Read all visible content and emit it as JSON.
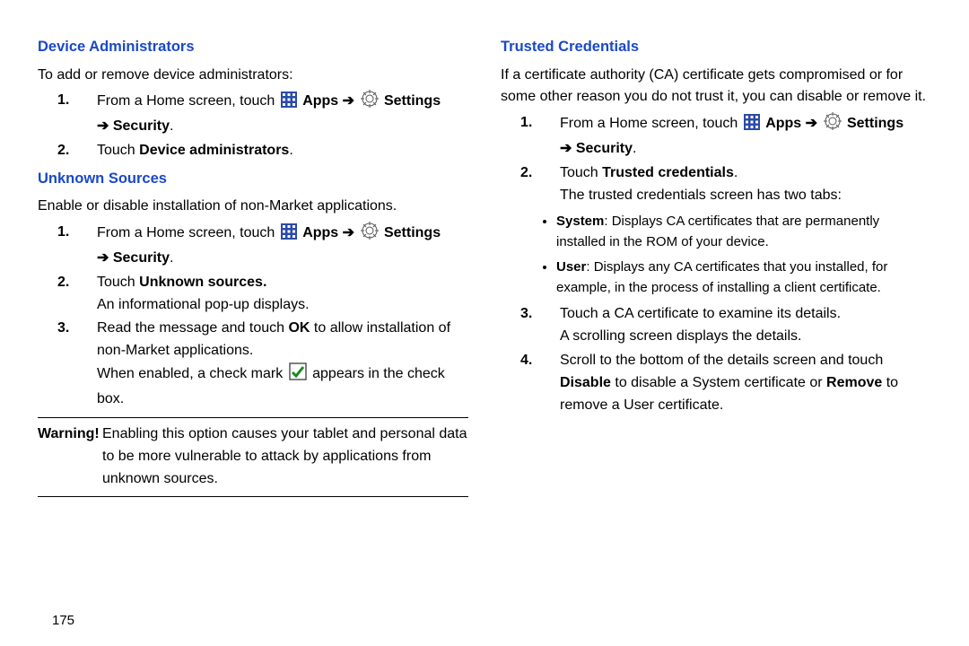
{
  "left": {
    "heading1": "Device Administrators",
    "intro1": "To add or remove device administrators:",
    "step1_pre": "From a Home screen, touch ",
    "apps": "Apps",
    "settings": "Settings",
    "security": "Security",
    "step2_pre": "Touch ",
    "step2_bold": "Device administrators",
    "heading2": "Unknown Sources",
    "intro2": "Enable or disable installation of non-Market applications.",
    "us_step1_pre": "From a Home screen, touch ",
    "us_step2_pre": "Touch ",
    "us_step2_bold": "Unknown sources.",
    "us_step2_after": "An informational pop-up displays.",
    "us_step3_pre": "Read the message and touch ",
    "us_step3_bold": "OK",
    "us_step3_post": " to allow installation of non-Market applications.",
    "us_step3_after_pre": "When enabled, a check mark ",
    "us_step3_after_post": " appears in the check box.",
    "warning_label": "Warning!",
    "warning_body": "Enabling this option causes your tablet and personal data to be more vulnerable to attack by applications from unknown sources."
  },
  "right": {
    "heading": "Trusted Credentials",
    "intro": "If a certificate authority (CA) certificate gets compromised or for some other reason you do not trust it, you can disable or remove it.",
    "step1_pre": "From a Home screen, touch ",
    "apps": "Apps",
    "settings": "Settings",
    "security": "Security",
    "step2_pre": "Touch ",
    "step2_bold": "Trusted credentials",
    "step2_after": "The trusted credentials screen has two tabs:",
    "bullet1_label": "System",
    "bullet1_rest": ": Displays CA certificates that are permanently installed in the ROM of your device.",
    "bullet2_label": "User",
    "bullet2_rest": ": Displays any CA certificates that you installed, for example, in the process of installing a client certificate.",
    "step3_line1": "Touch a CA certificate to examine its details.",
    "step3_line2": "A scrolling screen displays the details.",
    "step4_pre": "Scroll to the bottom of the details screen and touch ",
    "step4_bold1": "Disable",
    "step4_mid": " to disable a System certificate or ",
    "step4_bold2": "Remove",
    "step4_post": " to remove a User certificate."
  },
  "page_number": "175",
  "num": {
    "n1": "1.",
    "n2": "2.",
    "n3": "3.",
    "n4": "4."
  },
  "sym": {
    "arrow": "➔",
    "period": ".",
    "space": " "
  }
}
